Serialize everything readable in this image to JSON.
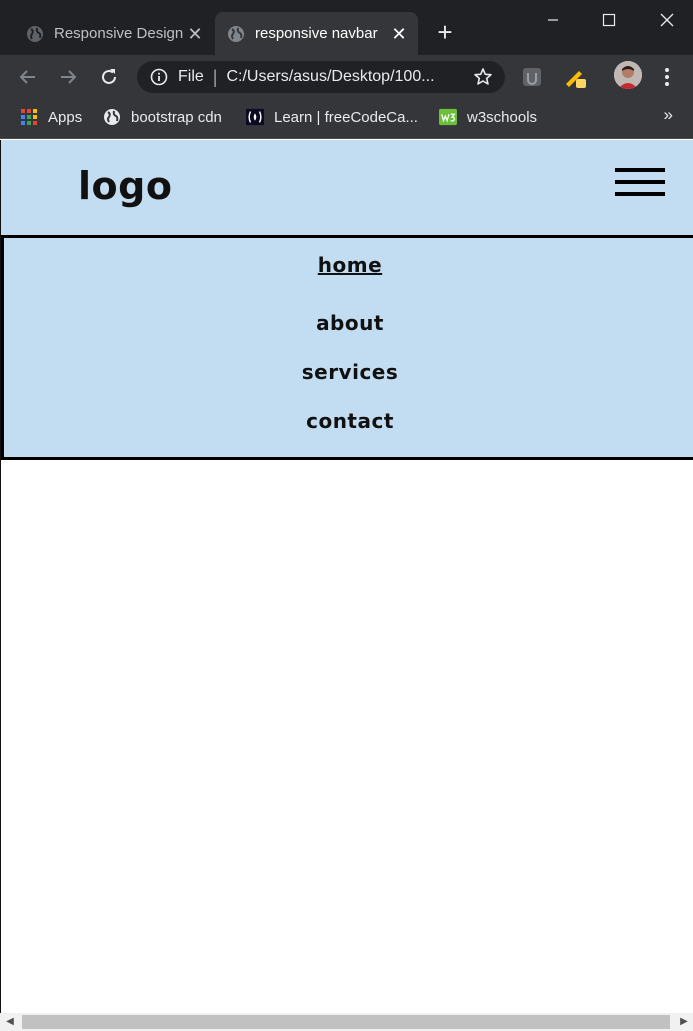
{
  "browser": {
    "tabs": [
      {
        "title": "Responsive Design",
        "active": false,
        "icon": "globe-icon"
      },
      {
        "title": "responsive navbar",
        "active": true,
        "icon": "globe-icon"
      }
    ],
    "new_tab_label": "+",
    "close_glyph": "✕",
    "address": {
      "scheme_label": "File",
      "separator": "|",
      "url": "C:/Users/asus/Desktop/100..."
    },
    "bookmarks": [
      {
        "label": "Apps",
        "icon": "apps-grid-icon"
      },
      {
        "label": "bootstrap cdn",
        "icon": "globe-icon"
      },
      {
        "label": "Learn | freeCodeCa...",
        "icon": "freecodecamp-icon"
      },
      {
        "label": "w3schools",
        "icon": "w3schools-icon"
      }
    ],
    "bookmarks_more": "»",
    "colors": {
      "titlebar": "#202124",
      "toolbar": "#35363a",
      "text": "#e8eaed"
    }
  },
  "page": {
    "logo": "logo",
    "menu": [
      {
        "label": "home",
        "active": true
      },
      {
        "label": "about",
        "active": false
      },
      {
        "label": "services",
        "active": false
      },
      {
        "label": "contact",
        "active": false
      }
    ],
    "colors": {
      "header_bg": "#c2ddf1",
      "text": "#111111"
    }
  }
}
